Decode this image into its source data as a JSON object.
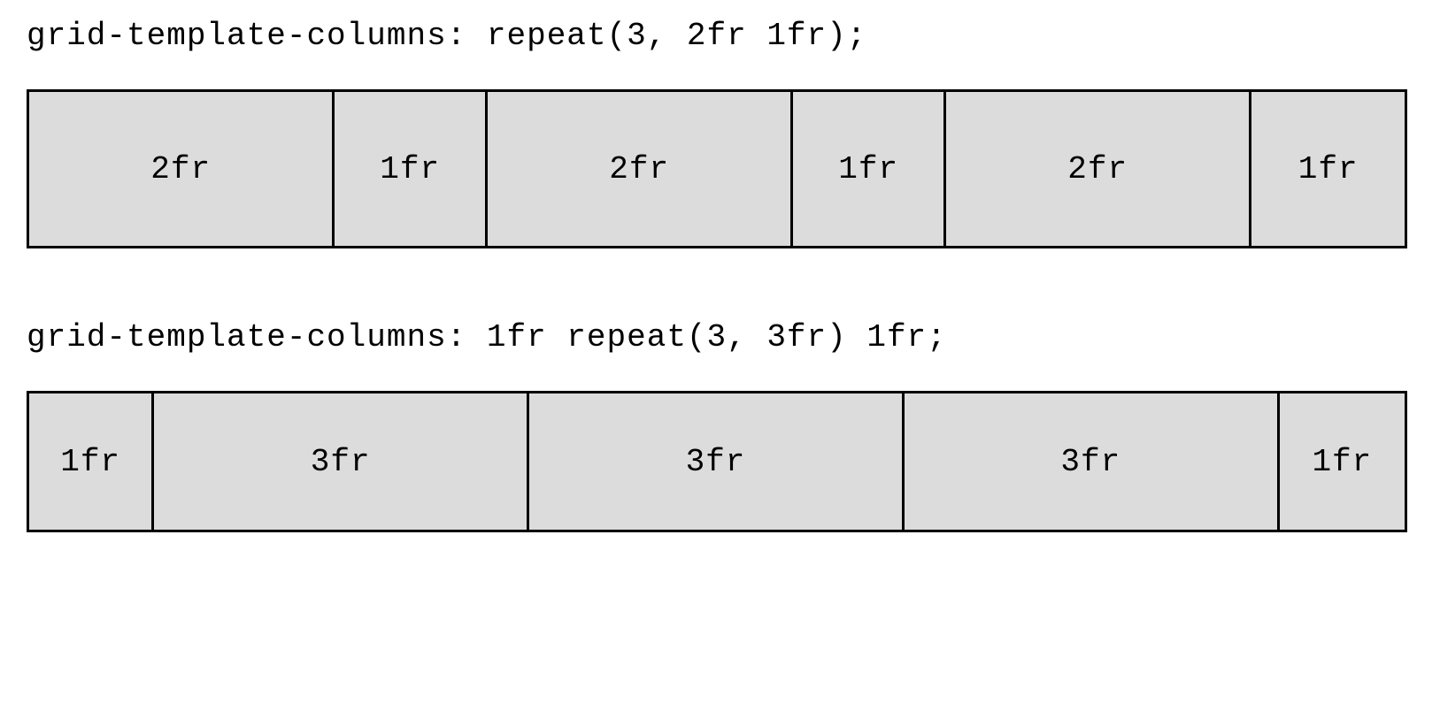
{
  "examples": [
    {
      "code": "grid-template-columns: repeat(3, 2fr 1fr);",
      "cells": [
        "2fr",
        "1fr",
        "2fr",
        "1fr",
        "2fr",
        "1fr"
      ]
    },
    {
      "code": "grid-template-columns: 1fr repeat(3, 3fr) 1fr;",
      "cells": [
        "1fr",
        "3fr",
        "3fr",
        "3fr",
        "1fr"
      ]
    }
  ]
}
